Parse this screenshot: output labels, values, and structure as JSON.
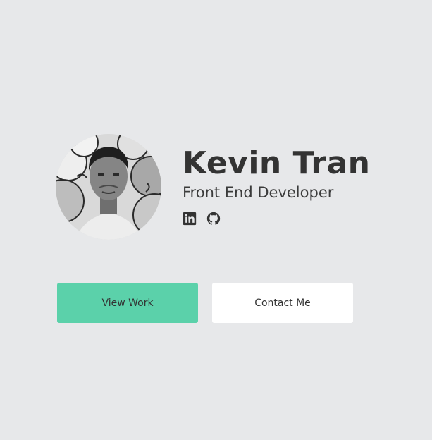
{
  "profile": {
    "name": "Kevin Tran",
    "role": "Front End Developer"
  },
  "socials": [
    {
      "icon": "linkedin-icon"
    },
    {
      "icon": "github-icon"
    }
  ],
  "buttons": {
    "primary_label": "View Work",
    "secondary_label": "Contact Me"
  },
  "colors": {
    "background": "#e7e8ea",
    "accent": "#5bd1aa",
    "text": "#333333",
    "secondary_button": "#ffffff"
  }
}
